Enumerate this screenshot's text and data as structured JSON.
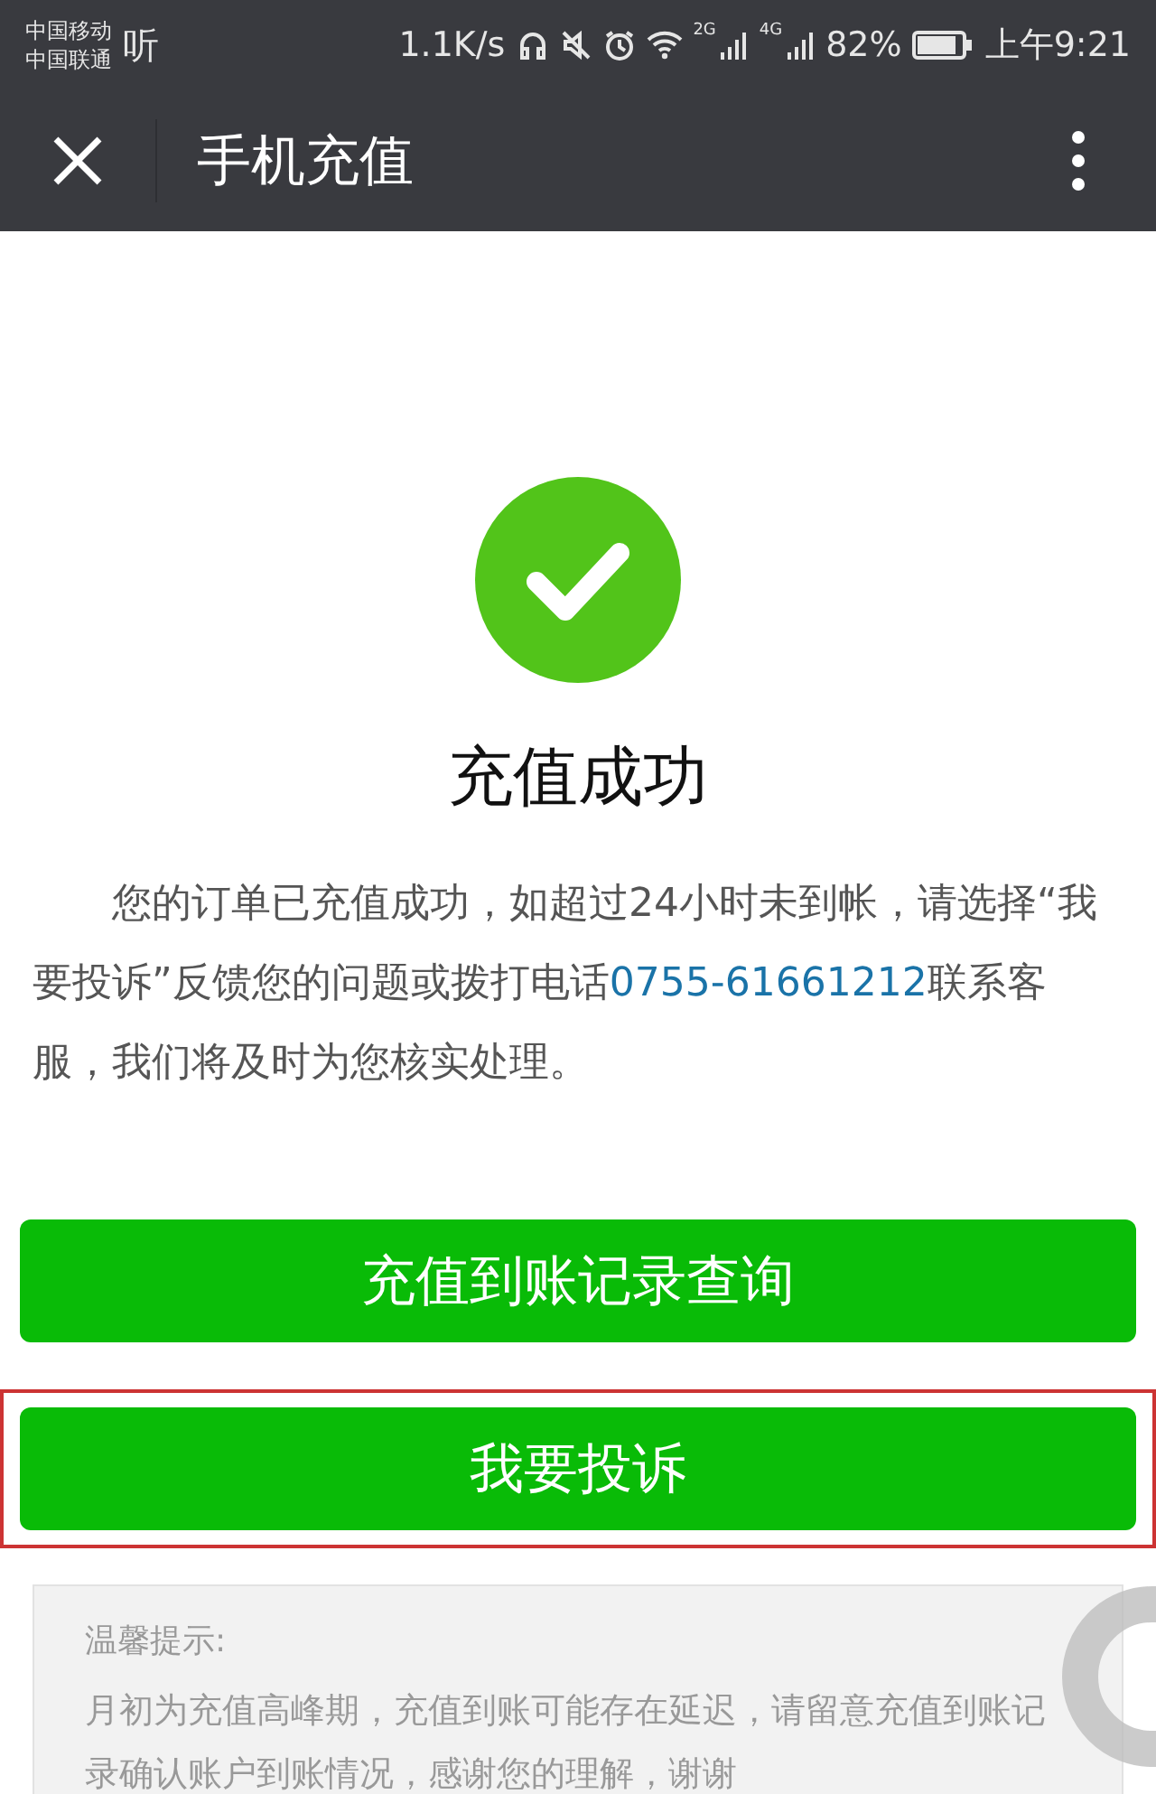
{
  "status_bar": {
    "carriers": [
      "中国移动",
      "中国联通"
    ],
    "listen": "听",
    "speed": "1.1K/s",
    "networks": [
      "2G",
      "4G"
    ],
    "battery": "82%",
    "time": "上午9:21"
  },
  "nav": {
    "title": "手机充值"
  },
  "result": {
    "title": "充值成功",
    "message_before": "您的订单已充值成功，如超过24小时未到帐，请选择“我要投诉”反馈您的问题或拨打电话",
    "phone": "0755-61661212",
    "message_after": "联系客服，我们将及时为您核实处理。"
  },
  "buttons": [
    {
      "label": "充值到账记录查询",
      "highlighted": false
    },
    {
      "label": "我要投诉",
      "highlighted": true
    }
  ],
  "tip": {
    "title": "温馨提示:",
    "text": "月初为充值高峰期，充值到账可能存在延迟，请留意充值到账记录确认账户到账情况，感谢您的理解，谢谢"
  }
}
